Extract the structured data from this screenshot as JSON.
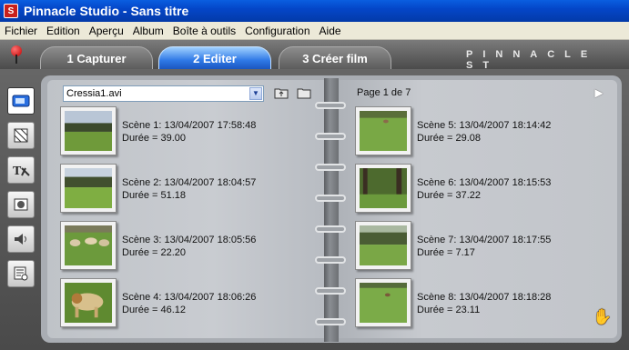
{
  "window": {
    "title": "Pinnacle Studio - Sans titre"
  },
  "menu": [
    "Fichier",
    "Edition",
    "Aperçu",
    "Album",
    "Boîte à outils",
    "Configuration",
    "Aide"
  ],
  "tabs": [
    {
      "label": "1 Capturer",
      "active": false
    },
    {
      "label": "2 Editer",
      "active": true
    },
    {
      "label": "3 Créer film",
      "active": false
    }
  ],
  "brand": "PINNACLE ST",
  "album": {
    "file": "Cressia1.avi",
    "page_label": "Page 1 de 7",
    "scenes": [
      {
        "title": "Scène 1: 13/04/2007 17:58:48",
        "duration": "Durée = 39.00",
        "thumb": "field-trees"
      },
      {
        "title": "Scène 2: 13/04/2007 18:04:57",
        "duration": "Durée = 51.18",
        "thumb": "field-trees"
      },
      {
        "title": "Scène 3: 13/04/2007 18:05:56",
        "duration": "Durée = 22.20",
        "thumb": "cows-field"
      },
      {
        "title": "Scène 4: 13/04/2007 18:06:26",
        "duration": "Durée = 46.12",
        "thumb": "cow-closeup"
      },
      {
        "title": "Scène 5: 13/04/2007 18:14:42",
        "duration": "Durée = 29.08",
        "thumb": "meadow"
      },
      {
        "title": "Scène 6: 13/04/2007 18:15:53",
        "duration": "Durée = 37.22",
        "thumb": "forest"
      },
      {
        "title": "Scène 7: 13/04/2007 18:17:55",
        "duration": "Durée = 7.17",
        "thumb": "meadow-trees"
      },
      {
        "title": "Scène 8: 13/04/2007 18:18:28",
        "duration": "Durée = 23.11",
        "thumb": "meadow"
      }
    ]
  },
  "sidebar_icons": [
    "video-clips-icon",
    "transitions-icon",
    "titles-icon",
    "photos-icon",
    "sound-effects-icon",
    "menus-icon"
  ],
  "colors": {
    "titlebar": "#0446c8",
    "active_tab": "#2f79e6",
    "page": "#c5c8cd"
  }
}
